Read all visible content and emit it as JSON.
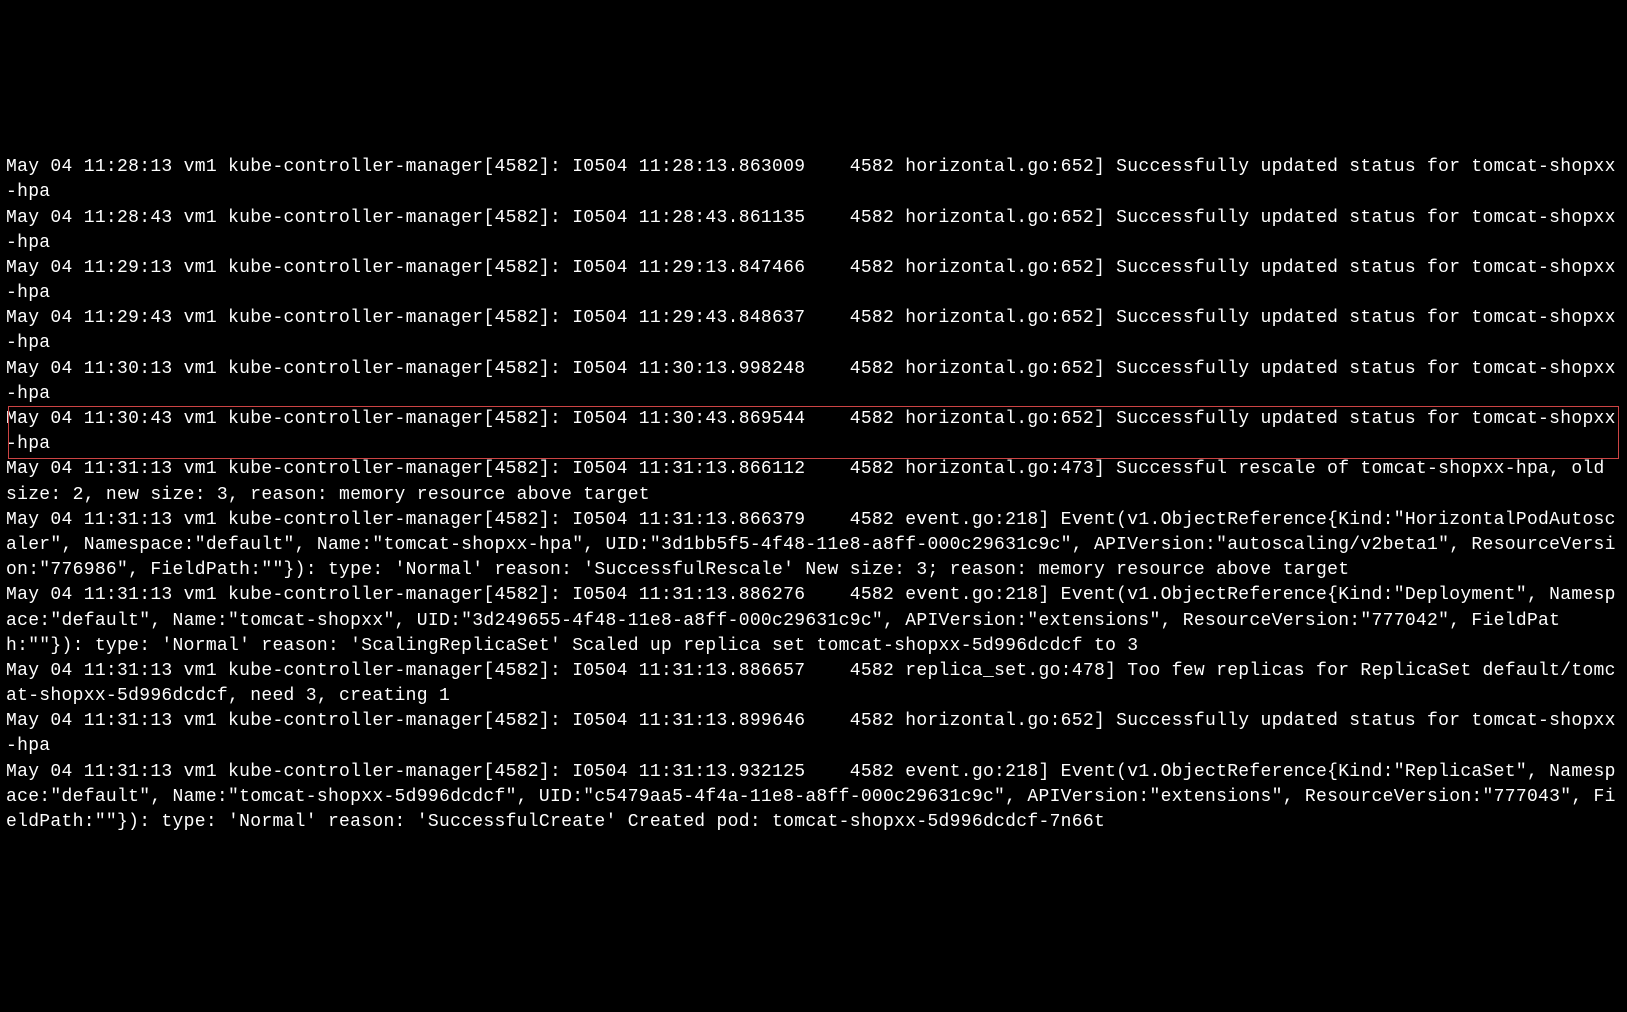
{
  "log_lines": [
    "May 04 11:28:13 vm1 kube-controller-manager[4582]: I0504 11:28:13.863009    4582 horizontal.go:652] Successfully updated status for tomcat-shopxx-hpa",
    "May 04 11:28:43 vm1 kube-controller-manager[4582]: I0504 11:28:43.861135    4582 horizontal.go:652] Successfully updated status for tomcat-shopxx-hpa",
    "May 04 11:29:13 vm1 kube-controller-manager[4582]: I0504 11:29:13.847466    4582 horizontal.go:652] Successfully updated status for tomcat-shopxx-hpa",
    "May 04 11:29:43 vm1 kube-controller-manager[4582]: I0504 11:29:43.848637    4582 horizontal.go:652] Successfully updated status for tomcat-shopxx-hpa",
    "May 04 11:30:13 vm1 kube-controller-manager[4582]: I0504 11:30:13.998248    4582 horizontal.go:652] Successfully updated status for tomcat-shopxx-hpa",
    "May 04 11:30:43 vm1 kube-controller-manager[4582]: I0504 11:30:43.869544    4582 horizontal.go:652] Successfully updated status for tomcat-shopxx-hpa",
    "May 04 11:31:13 vm1 kube-controller-manager[4582]: I0504 11:31:13.866112    4582 horizontal.go:473] Successful rescale of tomcat-shopxx-hpa, old size: 2, new size: 3, reason: memory resource above target",
    "May 04 11:31:13 vm1 kube-controller-manager[4582]: I0504 11:31:13.866379    4582 event.go:218] Event(v1.ObjectReference{Kind:\"HorizontalPodAutoscaler\", Namespace:\"default\", Name:\"tomcat-shopxx-hpa\", UID:\"3d1bb5f5-4f48-11e8-a8ff-000c29631c9c\", APIVersion:\"autoscaling/v2beta1\", ResourceVersion:\"776986\", FieldPath:\"\"}): type: 'Normal' reason: 'SuccessfulRescale' New size: 3; reason: memory resource above target",
    "May 04 11:31:13 vm1 kube-controller-manager[4582]: I0504 11:31:13.886276    4582 event.go:218] Event(v1.ObjectReference{Kind:\"Deployment\", Namespace:\"default\", Name:\"tomcat-shopxx\", UID:\"3d249655-4f48-11e8-a8ff-000c29631c9c\", APIVersion:\"extensions\", ResourceVersion:\"777042\", FieldPath:\"\"}): type: 'Normal' reason: 'ScalingReplicaSet' Scaled up replica set tomcat-shopxx-5d996dcdcf to 3",
    "May 04 11:31:13 vm1 kube-controller-manager[4582]: I0504 11:31:13.886657    4582 replica_set.go:478] Too few replicas for ReplicaSet default/tomcat-shopxx-5d996dcdcf, need 3, creating 1",
    "May 04 11:31:13 vm1 kube-controller-manager[4582]: I0504 11:31:13.899646    4582 horizontal.go:652] Successfully updated status for tomcat-shopxx-hpa",
    "May 04 11:31:13 vm1 kube-controller-manager[4582]: I0504 11:31:13.932125    4582 event.go:218] Event(v1.ObjectReference{Kind:\"ReplicaSet\", Namespace:\"default\", Name:\"tomcat-shopxx-5d996dcdcf\", UID:\"c5479aa5-4f4a-11e8-a8ff-000c29631c9c\", APIVersion:\"extensions\", ResourceVersion:\"777043\", FieldPath:\"\"}): type: 'Normal' reason: 'SuccessfulCreate' Created pod: tomcat-shopxx-5d996dcdcf-7n66t"
  ],
  "highlight": {
    "line_index": 6
  }
}
